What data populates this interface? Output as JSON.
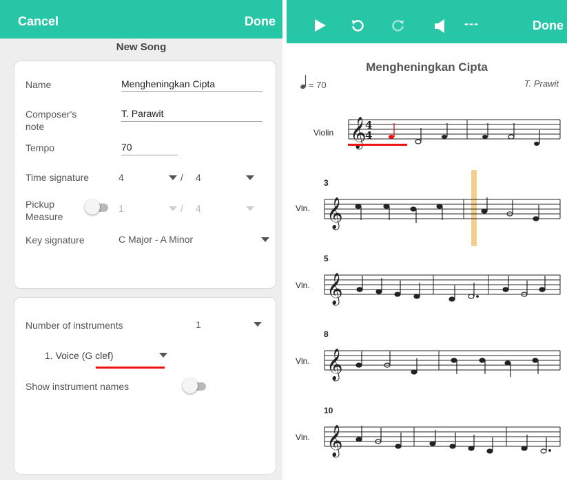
{
  "editor": {
    "cancel_label": "Cancel",
    "done_label": "Done",
    "subtitle": "New Song",
    "name_label": "Name",
    "name_value": "Mengheningkan Cipta",
    "composer_label": "Composer's note",
    "composer_value": "T. Parawit",
    "tempo_label": "Tempo",
    "tempo_value": "70",
    "time_sig_label": "Time signature",
    "time_sig_top": "4",
    "time_sig_sep": "/",
    "time_sig_bottom": "4",
    "pickup_label": "Pickup Measure",
    "pickup_top": "1",
    "pickup_sep": "/",
    "pickup_bottom": "4",
    "key_label": "Key signature",
    "key_value": "C Major - A Minor",
    "instruments_label": "Number of instruments",
    "instruments_value": "1",
    "instrument_1": "1.  Voice (G clef)",
    "show_names_label": "Show instrument names"
  },
  "player": {
    "done_label": "Done",
    "title": "Mengheningkan Cipta",
    "tempo_text": "= 70",
    "composer": "T. Prawit",
    "volume_text": "---",
    "time_sig_top": "4",
    "time_sig_bottom": "4",
    "systems": [
      {
        "instrument": "Violin",
        "measure_no": ""
      },
      {
        "instrument": "Vln.",
        "measure_no": "3"
      },
      {
        "instrument": "Vln.",
        "measure_no": "5"
      },
      {
        "instrument": "Vln.",
        "measure_no": "8"
      },
      {
        "instrument": "Vln.",
        "measure_no": "10"
      }
    ]
  },
  "icons": [
    "play-icon",
    "undo-icon",
    "redo-icon",
    "speaker-icon",
    "quarter-note-icon",
    "treble-clef-icon",
    "dropdown-arrow-icon"
  ],
  "colors": {
    "accent": "#26c6a6",
    "highlight": "#e11111",
    "playhead": "#f3cf8f"
  }
}
